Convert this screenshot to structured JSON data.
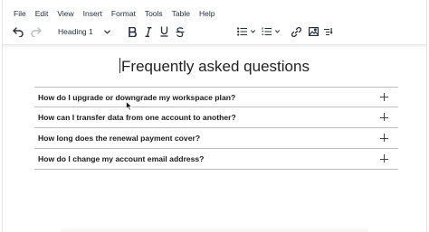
{
  "menubar": {
    "items": [
      "File",
      "Edit",
      "View",
      "Insert",
      "Format",
      "Tools",
      "Table",
      "Help"
    ]
  },
  "toolbar": {
    "block_format": "Heading 1",
    "icons": [
      "undo-icon",
      "redo-icon",
      "bold-icon",
      "italic-icon",
      "underline-icon",
      "strikethrough-icon",
      "bullet-list-icon",
      "numbered-list-icon",
      "link-icon",
      "image-icon",
      "more-icon"
    ]
  },
  "document": {
    "title": "Frequently asked questions",
    "faq": [
      {
        "question": "How do I upgrade or downgrade my workspace plan?"
      },
      {
        "question": "How can I transfer data from one account to another?"
      },
      {
        "question": "How long does the renewal payment cover?"
      },
      {
        "question": "How do I change my account email address?"
      }
    ]
  }
}
